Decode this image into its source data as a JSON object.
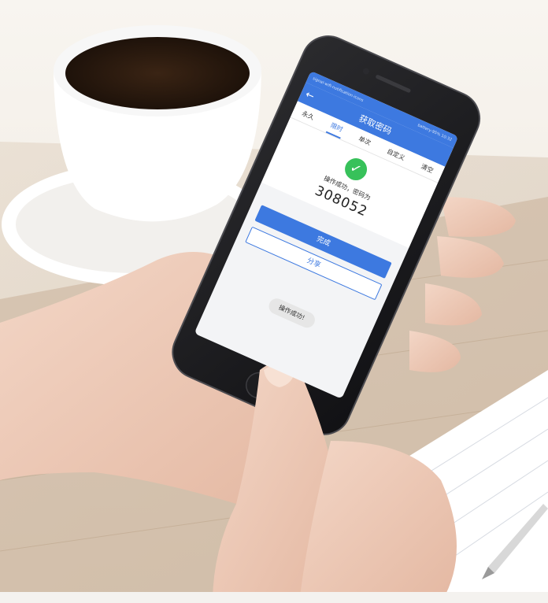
{
  "phone": {
    "status_bar": {
      "icons_left": "signal-wifi-notification-icons",
      "icons_right": "battery-95% 10:32"
    },
    "app_bar": {
      "back_icon": "arrow-left-icon",
      "title": "获取密码"
    },
    "tabs": [
      {
        "label": "永久"
      },
      {
        "label": "限时",
        "active": true
      },
      {
        "label": "单次"
      },
      {
        "label": "自定义"
      },
      {
        "label": "清空"
      }
    ],
    "result": {
      "icon": "check-circle-icon",
      "message": "操作成功，密码为",
      "password": "308052"
    },
    "buttons": {
      "primary": "完成",
      "secondary": "分享"
    },
    "toast": "操作成功!"
  },
  "colors": {
    "accent": "#3d79e0",
    "success": "#37c15a",
    "table": "#c9b49c",
    "background": "#f4efe8"
  }
}
